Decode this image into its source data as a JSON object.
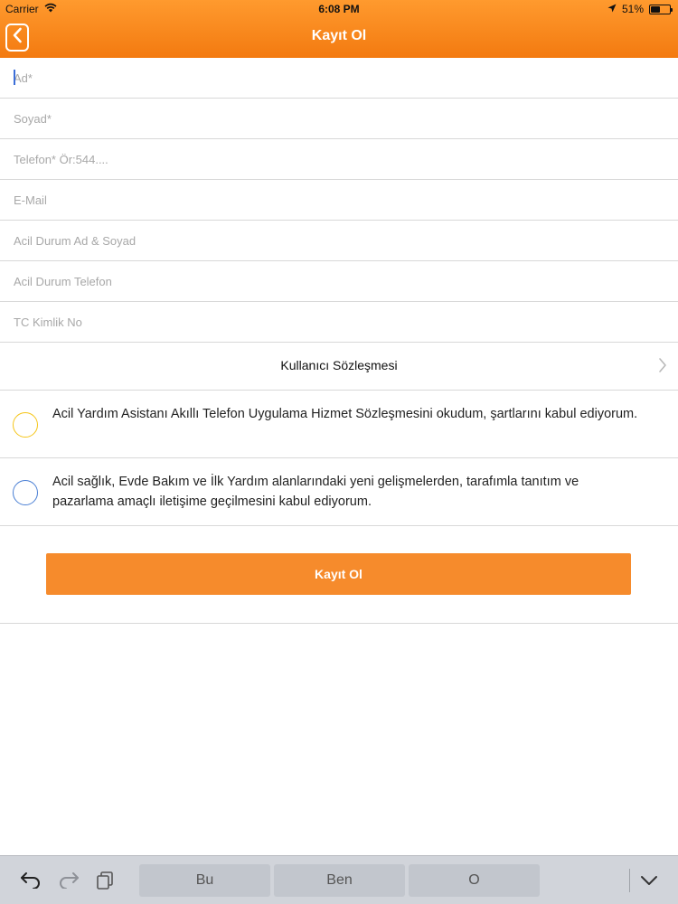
{
  "status": {
    "carrier": "Carrier",
    "time": "6:08 PM",
    "battery": "51%",
    "battery_level": 0.51
  },
  "nav": {
    "title": "Kayıt Ol"
  },
  "form": {
    "fields": [
      {
        "placeholder": "Ad*"
      },
      {
        "placeholder": "Soyad*"
      },
      {
        "placeholder": "Telefon* Ör:544...."
      },
      {
        "placeholder": "E-Mail"
      },
      {
        "placeholder": "Acil Durum Ad & Soyad"
      },
      {
        "placeholder": "Acil Durum Telefon"
      },
      {
        "placeholder": "TC Kimlik No"
      }
    ],
    "agreement_link": "Kullanıcı Sözleşmesi",
    "consents": [
      {
        "text": "Acil Yardım Asistanı Akıllı Telefon Uygulama Hizmet Sözleşmesini okudum, şartlarını kabul ediyorum.",
        "color": "#f5c518"
      },
      {
        "text": "Acil sağlık, Evde Bakım ve İlk Yardım alanlarındaki yeni gelişmelerden, tarafımla tanıtım ve pazarlama amaçlı iletişime geçilmesini kabul ediyorum.",
        "color": "#4a7fd4"
      }
    ],
    "submit_label": "Kayıt Ol"
  },
  "keyboard": {
    "suggestions": [
      "Bu",
      "Ben",
      "O"
    ]
  },
  "colors": {
    "accent": "#f68b2c",
    "nav_top": "#ff9a2e",
    "nav_bottom": "#f37a10"
  }
}
